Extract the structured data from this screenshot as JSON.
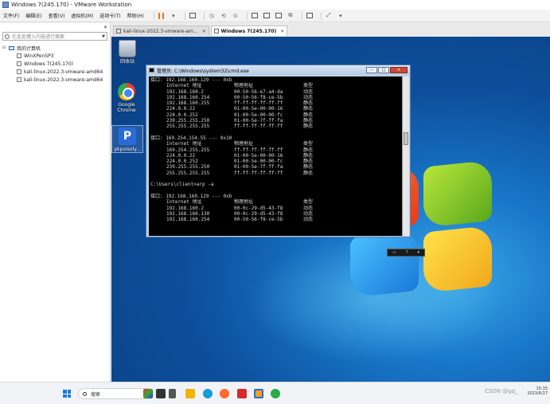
{
  "window": {
    "title": "Windows 7(245.170) - VMware Workstation"
  },
  "menubar": {
    "items": [
      "文件(F)",
      "编辑(E)",
      "查看(V)",
      "虚拟机(M)",
      "选项卡(T)",
      "帮助(H)"
    ]
  },
  "library": {
    "search_placeholder": "在此处键入内容进行搜索",
    "root_label": "我的计算机",
    "vms": [
      "WinXPenSP3",
      "Windows 7(245.170)",
      "kali-linux-2022.3-vmware-amd64",
      "kali-linux-2022.3-vmware-amd64"
    ]
  },
  "tabs": [
    {
      "label": "kali-linux-2022.3-vmware-am...",
      "active": false
    },
    {
      "label": "Windows 7(245.170)",
      "active": true
    }
  ],
  "desktop": {
    "icons": [
      {
        "label": "回收站",
        "icon": "recycle-bin-icon"
      },
      {
        "label": "Google Chrome",
        "icon": "chrome-icon"
      },
      {
        "label": "pkpoisoly...",
        "icon": "app-p-icon"
      }
    ]
  },
  "cmd": {
    "title": "管理员: C:\\Windows\\system32\\cmd.exe",
    "lines": [
      [
        "接口: 192.168.160.129 --- 0xb"
      ],
      [
        "",
        "Internet 地址",
        "物理地址",
        "类型"
      ],
      [
        "",
        "192.168.160.2",
        "00-50-56-e7-a4-da",
        "动态"
      ],
      [
        "",
        "192.168.160.254",
        "00-50-56-f8-ce-5b",
        "动态"
      ],
      [
        "",
        "192.168.160.255",
        "ff-ff-ff-ff-ff-ff",
        "静态"
      ],
      [
        "",
        "224.0.0.22",
        "01-00-5e-00-00-16",
        "静态"
      ],
      [
        "",
        "224.0.0.252",
        "01-00-5e-00-00-fc",
        "静态"
      ],
      [
        "",
        "239.255.255.250",
        "01-00-5e-7f-ff-fa",
        "静态"
      ],
      [
        "",
        "255.255.255.255",
        "ff-ff-ff-ff-ff-ff",
        "静态"
      ],
      [
        ""
      ],
      [
        "接口: 169.254.154.55 --- 0x10"
      ],
      [
        "",
        "Internet 地址",
        "物理地址",
        "类型"
      ],
      [
        "",
        "169.254.255.255",
        "ff-ff-ff-ff-ff-ff",
        "静态"
      ],
      [
        "",
        "224.0.0.22",
        "01-00-5e-00-00-16",
        "静态"
      ],
      [
        "",
        "224.0.0.252",
        "01-00-5e-00-00-fc",
        "静态"
      ],
      [
        "",
        "239.255.255.250",
        "01-00-5e-7f-ff-fa",
        "静态"
      ],
      [
        "",
        "255.255.255.255",
        "ff-ff-ff-ff-ff-ff",
        "静态"
      ],
      [
        ""
      ],
      [
        "C:\\Users\\client>arp -a"
      ],
      [
        ""
      ],
      [
        "接口: 192.168.160.129 --- 0xb"
      ],
      [
        "",
        "Internet 地址",
        "物理地址",
        "类型"
      ],
      [
        "",
        "192.168.160.2",
        "00-0c-29-d5-43-f8",
        "动态"
      ],
      [
        "",
        "192.168.160.130",
        "00-0c-29-d5-43-f8",
        "动态"
      ],
      [
        "",
        "192.168.160.254",
        "00-50-56-f8-ce-5b",
        "动态"
      ]
    ]
  },
  "taskbar": {
    "search_placeholder": "搜索",
    "time": "15:15",
    "date": "2023/6/17"
  },
  "watermark": "CSDN @qq_"
}
